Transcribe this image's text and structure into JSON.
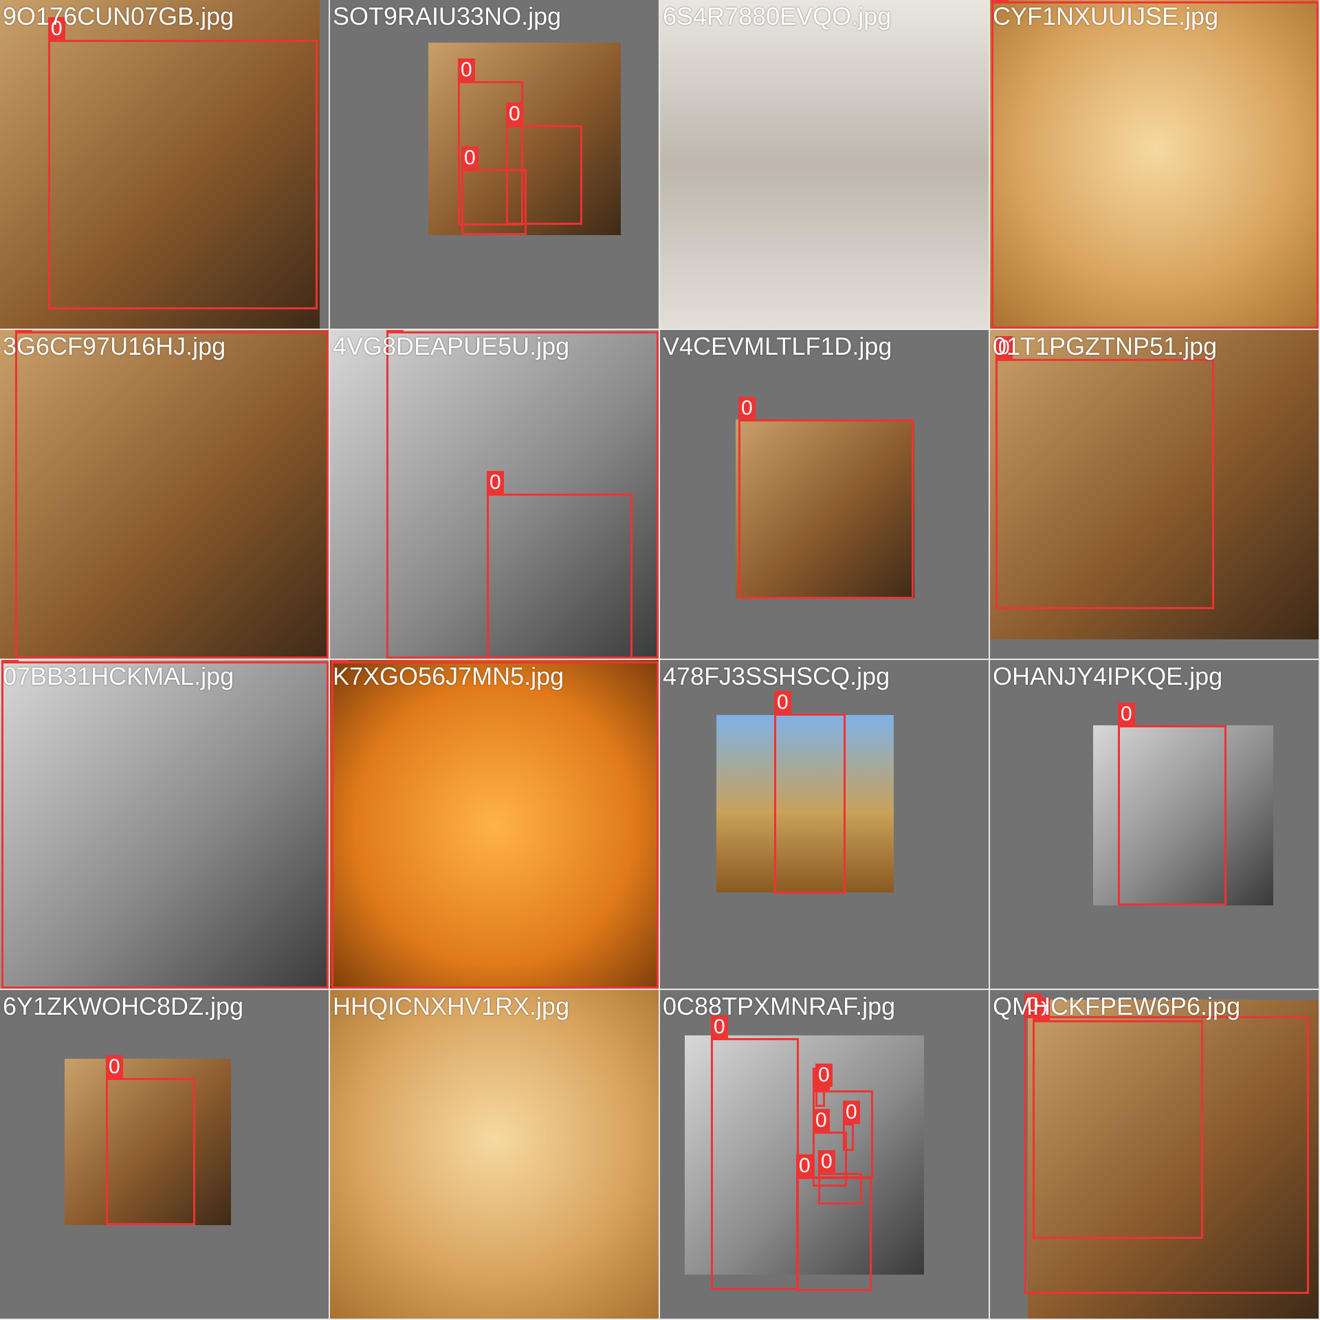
{
  "colors": {
    "box": "#ee3333",
    "tile_background": "#727272",
    "label_text": "#ffffff"
  },
  "tiles": [
    {
      "filename": "9O176CUN07GB.jpg",
      "photo_style": "warm",
      "detections": [
        "0"
      ]
    },
    {
      "filename": "SOT9RAIU33NO.jpg",
      "photo_style": "warm",
      "detections": [
        "0",
        "0",
        "0"
      ]
    },
    {
      "filename": "6S4R7880EVQO.jpg",
      "photo_style": "poster",
      "detections": []
    },
    {
      "filename": "CYF1NXUUIJSE.jpg",
      "photo_style": "gold",
      "detections": [
        "0"
      ]
    },
    {
      "filename": "3G6CF97U16HJ.jpg",
      "photo_style": "warm",
      "detections": [
        "0"
      ]
    },
    {
      "filename": "4VG8DEAPUE5U.jpg",
      "photo_style": "gray",
      "detections": [
        "0",
        "0"
      ]
    },
    {
      "filename": "V4CEVMLTLF1D.jpg",
      "photo_style": "warm",
      "detections": [
        "0"
      ]
    },
    {
      "filename": "01T1PGZTNP51.jpg",
      "photo_style": "warm",
      "detections": [
        "0"
      ]
    },
    {
      "filename": "07BB31HCKMAL.jpg",
      "photo_style": "gray",
      "detections": [
        "0"
      ]
    },
    {
      "filename": "K7XGO56J7MN5.jpg",
      "photo_style": "orange",
      "detections": [
        "0"
      ]
    },
    {
      "filename": "478FJ3SSHSCQ.jpg",
      "photo_style": "sky",
      "detections": [
        "0"
      ]
    },
    {
      "filename": "OHANJY4IPKQE.jpg",
      "photo_style": "gray",
      "detections": [
        "0"
      ]
    },
    {
      "filename": "6Y1ZKWOHC8DZ.jpg",
      "photo_style": "warm",
      "detections": [
        "0"
      ]
    },
    {
      "filename": "HHQICNXHV1RX.jpg",
      "photo_style": "gold",
      "detections": []
    },
    {
      "filename": "0C88TPXMNRAF.jpg",
      "photo_style": "gray",
      "detections": [
        "0",
        "0",
        "0",
        "0",
        "0",
        "0",
        "0"
      ]
    },
    {
      "filename": "QMHCKFPEW6P6.jpg",
      "photo_style": "warm",
      "detections": [
        "0",
        "0"
      ]
    }
  ]
}
